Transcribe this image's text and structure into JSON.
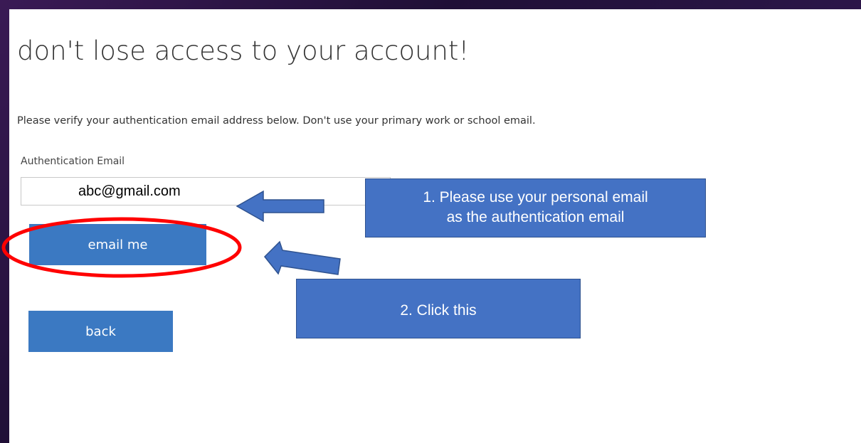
{
  "page": {
    "title": "don't lose access to your account!",
    "description": "Please verify your authentication email address below. Don't use your primary work or school email."
  },
  "form": {
    "email_label": "Authentication Email",
    "email_value": "abc@gmail.com",
    "email_button_label": "email me",
    "back_button_label": "back"
  },
  "annotations": {
    "callout_1_line_1": "1. Please use your personal email",
    "callout_1_line_2": "as the authentication email",
    "callout_2": "2. Click this"
  },
  "colors": {
    "button": "#3b79c2",
    "callout_fill": "#4472c4",
    "highlight_ring": "#ff0000",
    "background": "#1f0f36"
  },
  "icons": [
    "arrow-left-icon",
    "arrow-left-icon"
  ]
}
